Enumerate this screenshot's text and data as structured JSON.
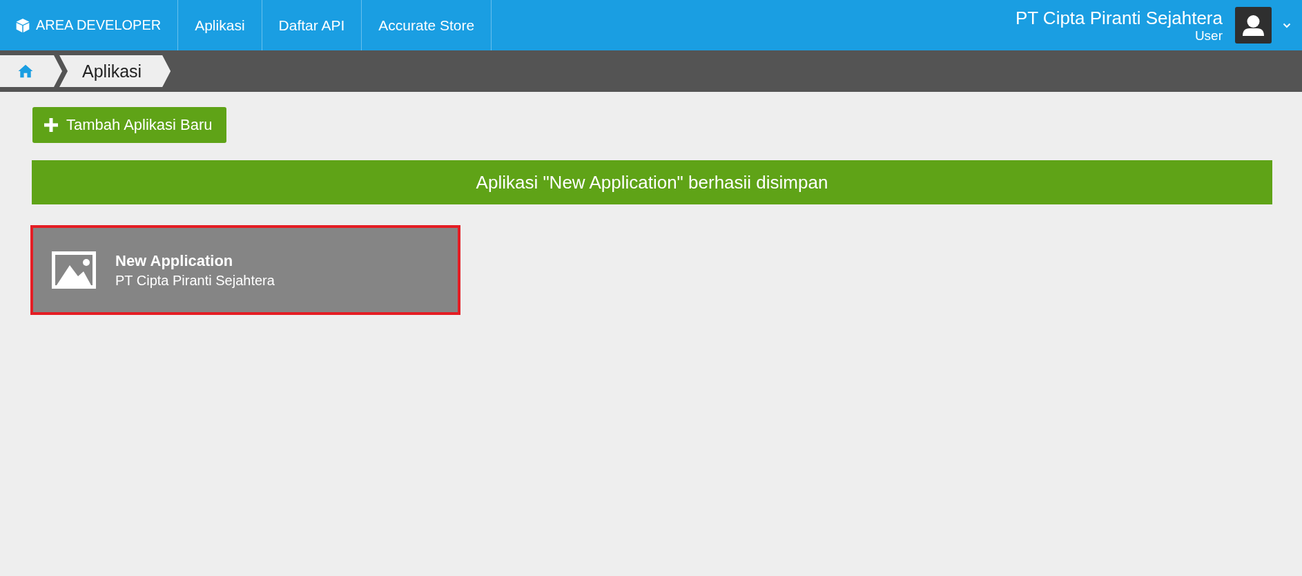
{
  "top_nav": {
    "brand": "AREA DEVELOPER",
    "items": [
      {
        "label": "Aplikasi"
      },
      {
        "label": "Daftar API"
      },
      {
        "label": "Accurate Store"
      }
    ]
  },
  "account": {
    "company": "PT Cipta Piranti Sejahtera",
    "role": "User"
  },
  "breadcrumb": [
    {
      "kind": "home"
    },
    {
      "kind": "page",
      "label": "Aplikasi"
    }
  ],
  "add_button": {
    "label": "Tambah Aplikasi Baru"
  },
  "alert": {
    "message": "Aplikasi \"New Application\" berhasii disimpan"
  },
  "apps": [
    {
      "name": "New Application",
      "owner": "PT Cipta Piranti Sejahtera",
      "highlighted": true
    }
  ]
}
